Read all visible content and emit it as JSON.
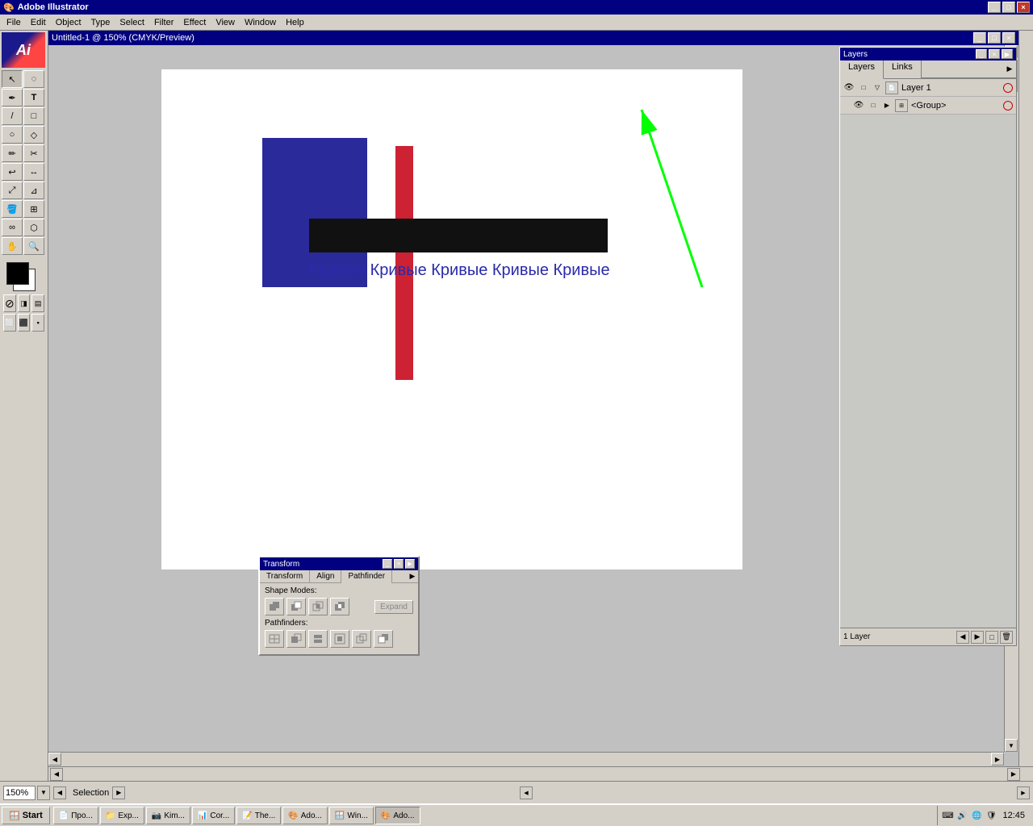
{
  "app": {
    "title": "Adobe Illustrator",
    "win_controls": [
      "_",
      "□",
      "×"
    ]
  },
  "menu": {
    "items": [
      "File",
      "Edit",
      "Object",
      "Type",
      "Select",
      "Filter",
      "Effect",
      "View",
      "Window",
      "Help"
    ]
  },
  "document": {
    "title": "Untitled-1 @ 150% (CMYK/Preview)"
  },
  "tools": {
    "rows": [
      [
        "↖",
        "◌"
      ],
      [
        "↗",
        "🔍"
      ],
      [
        "✒",
        "T"
      ],
      [
        "/",
        "□"
      ],
      [
        "○",
        "◇"
      ],
      [
        "✏",
        "✂"
      ],
      [
        "🪣",
        "🎨"
      ],
      [
        "↩",
        "🔗"
      ],
      [
        "📐",
        "🔭"
      ],
      [
        "✋",
        "🔍"
      ],
      [
        "⬚",
        "⬚"
      ]
    ]
  },
  "artwork": {
    "text_curves": "Кривые Кривые Кривые Кривые Кривые"
  },
  "layers_panel": {
    "title": "Layers",
    "tabs": [
      "Layers",
      "Links"
    ],
    "layers": [
      {
        "name": "Layer 1",
        "indent": 0,
        "has_arrow": false,
        "circle_color": "#cc0000"
      },
      {
        "name": "<Group>",
        "indent": 1,
        "has_arrow": true,
        "circle_color": "#cc0000"
      }
    ],
    "footer_text": "1 Layer",
    "footer_btns": [
      "◀",
      "▶",
      "□",
      "🗑"
    ]
  },
  "pathfinder": {
    "title": "Transform",
    "tabs": [
      "Transform",
      "Align",
      "Pathfinder"
    ],
    "active_tab": "Pathfinder",
    "shape_modes_label": "Shape Modes:",
    "shape_btns": [
      "⊕",
      "⊖",
      "⊗",
      "⊙"
    ],
    "expand_label": "Expand",
    "pathfinders_label": "Pathfinders:",
    "pathfinder_btns": [
      "⋂",
      "⋃",
      "⊃",
      "⊂",
      "÷",
      "⊿"
    ]
  },
  "status_bar": {
    "zoom": "150%",
    "zoom_arrow": "▼",
    "tool_name": "Selection"
  },
  "taskbar": {
    "start_label": "Start",
    "items": [
      {
        "label": "Про...",
        "active": false
      },
      {
        "label": "Exp...",
        "active": false
      },
      {
        "label": "Kim...",
        "active": false
      },
      {
        "label": "Cor...",
        "active": false
      },
      {
        "label": "The...",
        "active": false
      },
      {
        "label": "Adо...",
        "active": false
      },
      {
        "label": "Win...",
        "active": false
      },
      {
        "label": "Adо...",
        "active": true
      }
    ],
    "time": "12:45"
  }
}
